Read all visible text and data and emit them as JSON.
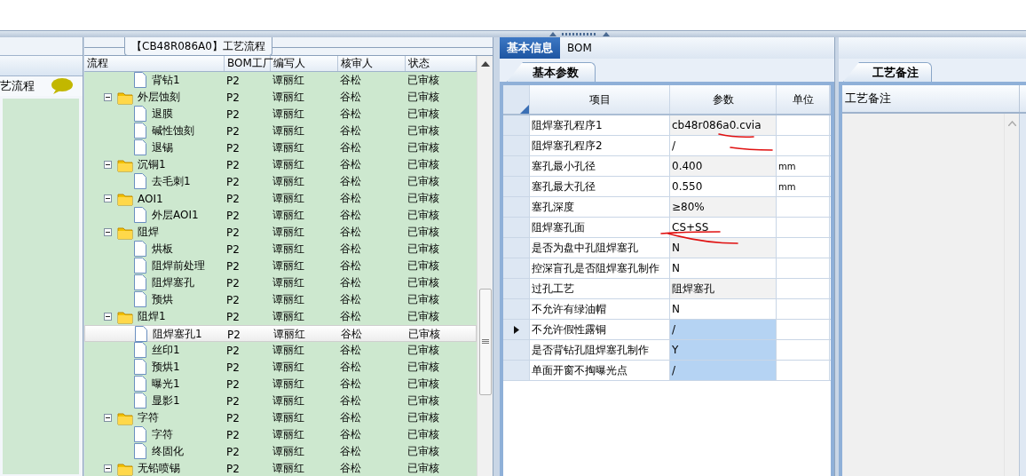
{
  "left_panel": {
    "item": {
      "label": "艺流程",
      "selected": true
    }
  },
  "process": {
    "group_title": "【CB48R086A0】工艺流程",
    "columns": [
      "流程",
      "BOM工厂",
      "编写人",
      "核审人",
      "状态"
    ],
    "tree": [
      {
        "kind": "file",
        "label": "背钻1",
        "bom": "P2",
        "author": "谭丽红",
        "reviewer": "谷松",
        "status": "已审核",
        "selected": false
      },
      {
        "kind": "folder",
        "label": "外层蚀刻",
        "bom": "P2",
        "author": "谭丽红",
        "reviewer": "谷松",
        "status": "已审核",
        "selected": false,
        "expanded": true,
        "children": [
          {
            "kind": "file",
            "label": "退膜",
            "bom": "P2",
            "author": "谭丽红",
            "reviewer": "谷松",
            "status": "已审核",
            "selected": false
          },
          {
            "kind": "file",
            "label": "碱性蚀刻",
            "bom": "P2",
            "author": "谭丽红",
            "reviewer": "谷松",
            "status": "已审核",
            "selected": false
          },
          {
            "kind": "file",
            "label": "退锡",
            "bom": "P2",
            "author": "谭丽红",
            "reviewer": "谷松",
            "status": "已审核",
            "selected": false
          }
        ]
      },
      {
        "kind": "folder",
        "label": "沉铜1",
        "bom": "P2",
        "author": "谭丽红",
        "reviewer": "谷松",
        "status": "已审核",
        "selected": false,
        "expanded": true,
        "children": [
          {
            "kind": "file",
            "label": "去毛刺1",
            "bom": "P2",
            "author": "谭丽红",
            "reviewer": "谷松",
            "status": "已审核",
            "selected": false
          }
        ]
      },
      {
        "kind": "folder",
        "label": "AOI1",
        "bom": "P2",
        "author": "谭丽红",
        "reviewer": "谷松",
        "status": "已审核",
        "selected": false,
        "expanded": true,
        "children": [
          {
            "kind": "file",
            "label": "外层AOI1",
            "bom": "P2",
            "author": "谭丽红",
            "reviewer": "谷松",
            "status": "已审核",
            "selected": false
          }
        ]
      },
      {
        "kind": "folder",
        "label": "阻焊",
        "bom": "P2",
        "author": "谭丽红",
        "reviewer": "谷松",
        "status": "已审核",
        "selected": false,
        "expanded": true,
        "children": [
          {
            "kind": "file",
            "label": "烘板",
            "bom": "P2",
            "author": "谭丽红",
            "reviewer": "谷松",
            "status": "已审核",
            "selected": false
          },
          {
            "kind": "file",
            "label": "阻焊前处理",
            "bom": "P2",
            "author": "谭丽红",
            "reviewer": "谷松",
            "status": "已审核",
            "selected": false
          },
          {
            "kind": "file",
            "label": "阻焊塞孔",
            "bom": "P2",
            "author": "谭丽红",
            "reviewer": "谷松",
            "status": "已审核",
            "selected": false
          },
          {
            "kind": "file",
            "label": "预烘",
            "bom": "P2",
            "author": "谭丽红",
            "reviewer": "谷松",
            "status": "已审核",
            "selected": false
          }
        ]
      },
      {
        "kind": "folder",
        "label": "阻焊1",
        "bom": "P2",
        "author": "谭丽红",
        "reviewer": "谷松",
        "status": "已审核",
        "selected": false,
        "expanded": true,
        "children": [
          {
            "kind": "file",
            "label": "阻焊塞孔1",
            "bom": "P2",
            "author": "谭丽红",
            "reviewer": "谷松",
            "status": "已审核",
            "selected": true
          },
          {
            "kind": "file",
            "label": "丝印1",
            "bom": "P2",
            "author": "谭丽红",
            "reviewer": "谷松",
            "status": "已审核",
            "selected": false
          },
          {
            "kind": "file",
            "label": "预烘1",
            "bom": "P2",
            "author": "谭丽红",
            "reviewer": "谷松",
            "status": "已审核",
            "selected": false
          },
          {
            "kind": "file",
            "label": "曝光1",
            "bom": "P2",
            "author": "谭丽红",
            "reviewer": "谷松",
            "status": "已审核",
            "selected": false
          },
          {
            "kind": "file",
            "label": "显影1",
            "bom": "P2",
            "author": "谭丽红",
            "reviewer": "谷松",
            "status": "已审核",
            "selected": false
          }
        ]
      },
      {
        "kind": "folder",
        "label": "字符",
        "bom": "P2",
        "author": "谭丽红",
        "reviewer": "谷松",
        "status": "已审核",
        "selected": false,
        "expanded": true,
        "children": [
          {
            "kind": "file",
            "label": "字符",
            "bom": "P2",
            "author": "谭丽红",
            "reviewer": "谷松",
            "status": "已审核",
            "selected": false
          },
          {
            "kind": "file",
            "label": "终固化",
            "bom": "P2",
            "author": "谭丽红",
            "reviewer": "谷松",
            "status": "已审核",
            "selected": false
          }
        ]
      },
      {
        "kind": "folder",
        "label": "无铅喷锡",
        "bom": "P2",
        "author": "谭丽红",
        "reviewer": "谷松",
        "status": "已审核",
        "selected": false,
        "expanded": true
      }
    ]
  },
  "info": {
    "tabs": [
      {
        "label": "基本信息",
        "selected": true
      },
      {
        "label": "BOM",
        "selected": false
      }
    ],
    "subtabs": [
      {
        "label": "基本参数",
        "selected": true
      }
    ],
    "columns": [
      "项目",
      "参数",
      "单位"
    ],
    "rows": [
      {
        "item": "阻焊塞孔程序1",
        "value": "cb48r086a0.cvia",
        "unit": "",
        "current": false,
        "selected": false
      },
      {
        "item": "阻焊塞孔程序2",
        "value": "/",
        "unit": "",
        "current": false,
        "selected": false
      },
      {
        "item": "塞孔最小孔径",
        "value": "0.400",
        "unit": "mm",
        "current": false,
        "selected": false
      },
      {
        "item": "塞孔最大孔径",
        "value": "0.550",
        "unit": "mm",
        "current": false,
        "selected": false
      },
      {
        "item": "塞孔深度",
        "value": "≥80%",
        "unit": "",
        "current": false,
        "selected": false
      },
      {
        "item": "阻焊塞孔面",
        "value": "CS+SS",
        "unit": "",
        "current": false,
        "selected": false
      },
      {
        "item": "是否为盘中孔阻焊塞孔",
        "value": "N",
        "unit": "",
        "current": false,
        "selected": false
      },
      {
        "item": "控深盲孔是否阻焊塞孔制作",
        "value": "N",
        "unit": "",
        "current": false,
        "selected": false
      },
      {
        "item": "过孔工艺",
        "value": "阻焊塞孔",
        "unit": "",
        "current": false,
        "selected": false
      },
      {
        "item": "不允许有绿油帽",
        "value": "N",
        "unit": "",
        "current": false,
        "selected": false
      },
      {
        "item": "不允许假性露铜",
        "value": "/",
        "unit": "",
        "current": true,
        "selected": true
      },
      {
        "item": "是否背钻孔阻焊塞孔制作",
        "value": "Y",
        "unit": "",
        "current": false,
        "selected": true
      },
      {
        "item": "单面开窗不掏曝光点",
        "value": "/",
        "unit": "",
        "current": false,
        "selected": true
      }
    ]
  },
  "notes": {
    "tabs": [
      {
        "label": "工艺备注",
        "selected": true
      }
    ],
    "columns": [
      "工艺备注"
    ]
  }
}
